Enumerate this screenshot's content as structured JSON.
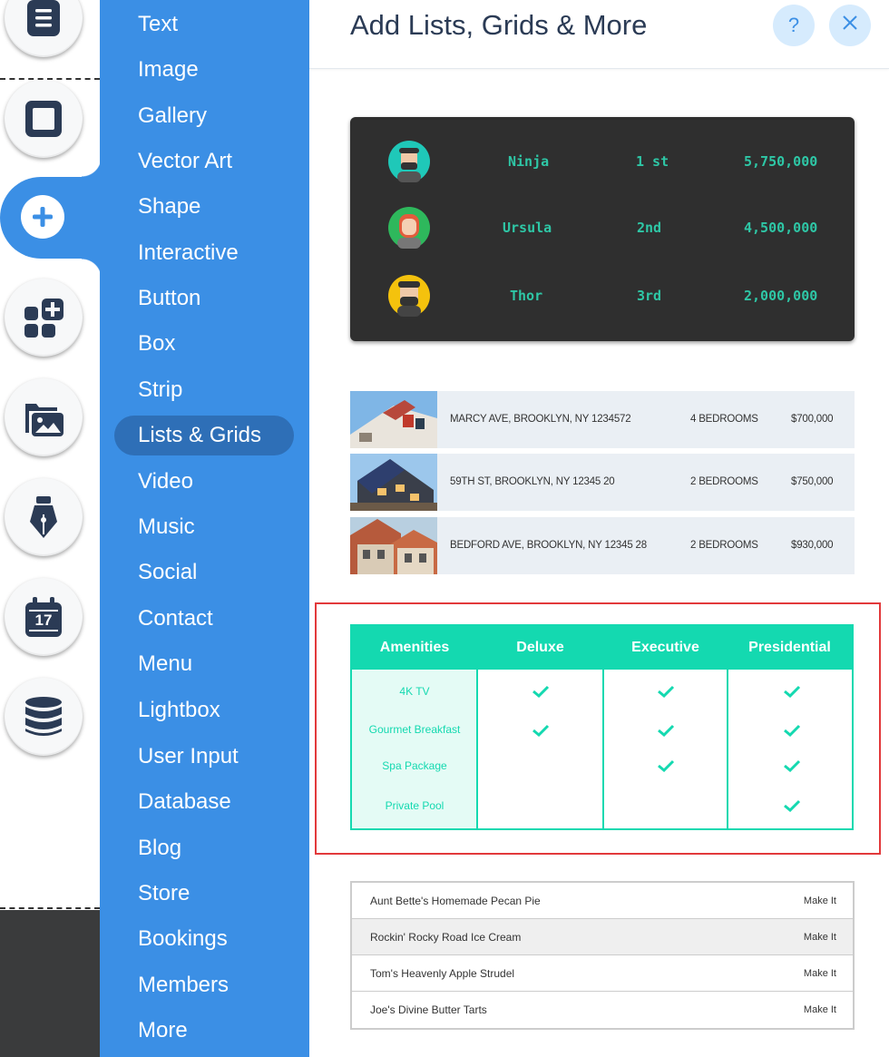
{
  "rail": {
    "buttons": [
      {
        "icon": "page-icon"
      },
      {
        "icon": "background-icon"
      },
      {
        "icon": "add-icon"
      },
      {
        "icon": "add-apps-icon"
      },
      {
        "icon": "media-icon"
      },
      {
        "icon": "pen-icon"
      },
      {
        "icon": "calendar-icon",
        "text": "17"
      },
      {
        "icon": "database-icon"
      }
    ]
  },
  "menu": {
    "items": [
      "Text",
      "Image",
      "Gallery",
      "Vector Art",
      "Shape",
      "Interactive",
      "Button",
      "Box",
      "Strip",
      "Lists & Grids",
      "Video",
      "Music",
      "Social",
      "Contact",
      "Menu",
      "Lightbox",
      "User Input",
      "Database",
      "Blog",
      "Store",
      "Bookings",
      "Members",
      "More"
    ],
    "active": "Lists & Grids"
  },
  "panel": {
    "title": "Add Lists, Grids & More",
    "help_label": "?",
    "close_label": "×"
  },
  "leaderboard": {
    "rows": [
      {
        "name": "Ninja",
        "rank": "1 st",
        "score": "5,750,000",
        "avatar_bg": "#1fc8b8"
      },
      {
        "name": "Ursula",
        "rank": "2nd",
        "score": "4,500,000",
        "avatar_bg": "#2eb85c"
      },
      {
        "name": "Thor",
        "rank": "3rd",
        "score": "2,000,000",
        "avatar_bg": "#f4c20d"
      }
    ]
  },
  "listings": [
    {
      "address": "MARCY AVE, BROOKLYN, NY 1234572",
      "bedrooms": "4 BEDROOMS",
      "price": "$700,000"
    },
    {
      "address": "59TH ST, BROOKLYN, NY 12345 20",
      "bedrooms": "2 BEDROOMS",
      "price": "$750,000"
    },
    {
      "address": "BEDFORD AVE, BROOKLYN, NY 12345 28",
      "bedrooms": "2 BEDROOMS",
      "price": "$930,000"
    }
  ],
  "amenities": {
    "headers": [
      "Amenities",
      "Deluxe",
      "Executive",
      "Presidential"
    ],
    "rows": [
      {
        "label": "4K TV",
        "checks": [
          true,
          true,
          true
        ]
      },
      {
        "label": "Gourmet Breakfast",
        "checks": [
          true,
          true,
          true
        ]
      },
      {
        "label": "Spa Package",
        "checks": [
          false,
          true,
          true
        ]
      },
      {
        "label": "Private Pool",
        "checks": [
          false,
          false,
          true
        ]
      }
    ]
  },
  "recipes": [
    {
      "name": "Aunt Bette's Homemade Pecan Pie",
      "action": "Make It"
    },
    {
      "name": "Rockin' Rocky Road Ice Cream",
      "action": "Make It"
    },
    {
      "name": "Tom's Heavenly Apple Strudel",
      "action": "Make It"
    },
    {
      "name": "Joe's Divine Butter Tarts",
      "action": "Make It"
    }
  ],
  "colors": {
    "menu_blue": "#3b8fe5",
    "accent_teal": "#14d9b0",
    "highlight_red": "#e2393b"
  }
}
